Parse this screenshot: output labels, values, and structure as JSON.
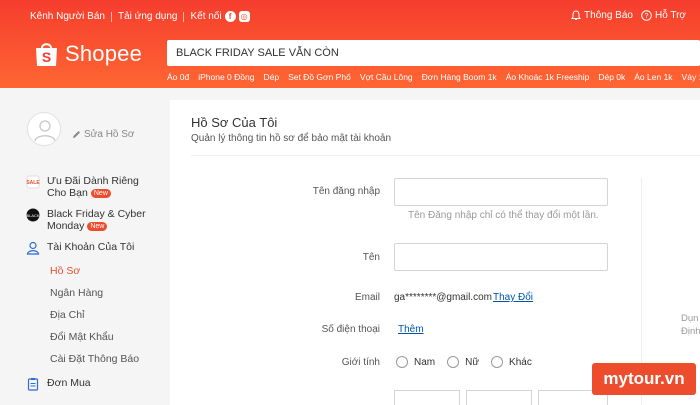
{
  "header": {
    "top_left_links": [
      "Kênh Người Bán",
      "Tải ứng dụng",
      "Kết nối"
    ],
    "top_right": {
      "notifications": "Thông Báo",
      "help": "Hỗ Trợ"
    },
    "logo_text": "Shopee",
    "search_value": "BLACK FRIDAY SALE VẪN CÒN",
    "suggestions": [
      "Áo 0đ",
      "iPhone 0 Đồng",
      "Dép",
      "Set Đồ Gơn Phố",
      "Vợt Cầu Lông",
      "Đơn Hàng Boom 1k",
      "Áo Khoác 1k Freeship",
      "Dép 0k",
      "Áo Len 1k",
      "Váy 1k"
    ],
    "colors": {
      "brand": "#ee4d2d"
    }
  },
  "sidebar": {
    "edit_profile": "Sửa Hồ Sơ",
    "items": [
      {
        "label_line1": "Ưu Đãi Dành Riêng",
        "label_line2": "Cho Bạn",
        "badge": "New",
        "icon": "deal-icon"
      },
      {
        "label_line1": "Black Friday & Cyber",
        "label_line2": "Monday",
        "badge": "New",
        "icon": "black-friday-icon"
      },
      {
        "label": "Tài Khoản Của Tôi",
        "icon": "user-icon"
      }
    ],
    "sub_items": [
      "Hồ Sơ",
      "Ngân Hàng",
      "Địa Chỉ",
      "Đổi Mật Khẩu",
      "Cài Đặt Thông Báo"
    ],
    "orders": "Đơn Mua"
  },
  "main": {
    "title": "Hồ Sơ Của Tôi",
    "subtitle": "Quản lý thông tin hồ sơ để bảo mật tài khoản",
    "username_label": "Tên đăng nhập",
    "username_value": "",
    "username_hint": "Tên Đăng nhập chỉ có thể thay đổi một lần.",
    "name_label": "Tên",
    "name_value": "",
    "email_label": "Email",
    "email_value": "ga********@gmail.com",
    "email_change": "Thay Đổi",
    "phone_label": "Số điện thoại",
    "phone_add": "Thêm",
    "gender_label": "Giới tính",
    "gender_options": [
      "Nam",
      "Nữ",
      "Khác"
    ],
    "right_partial": [
      "Dụn",
      "Định"
    ]
  },
  "watermark": "mytour.vn"
}
